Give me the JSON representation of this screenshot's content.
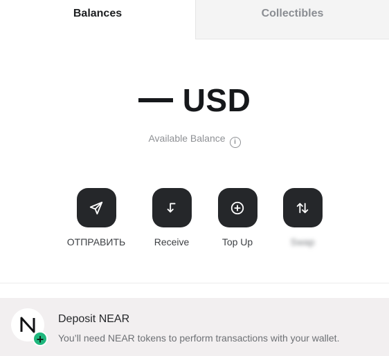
{
  "tabs": [
    {
      "label": "Balances",
      "active": true
    },
    {
      "label": "Collectibles",
      "active": false
    }
  ],
  "balance": {
    "value": "USD",
    "placeholder_glyph": "—",
    "available_label": "Available Balance"
  },
  "actions": [
    {
      "label": "ОТПРАВИТЬ",
      "icon": "send-icon"
    },
    {
      "label": "Receive",
      "icon": "receive-icon"
    },
    {
      "label": "Top Up",
      "icon": "top-up-icon"
    },
    {
      "label": "Swap",
      "icon": "swap-icon",
      "blurred": true
    }
  ],
  "deposit": {
    "title": "Deposit NEAR",
    "subtitle": "You’ll need NEAR tokens to perform transactions with your wallet.",
    "icon": "near-logo-icon"
  },
  "colors": {
    "button_bg": "#25272a",
    "deposit_bg": "#f2eff0",
    "plus_badge": "#1fb77d"
  }
}
